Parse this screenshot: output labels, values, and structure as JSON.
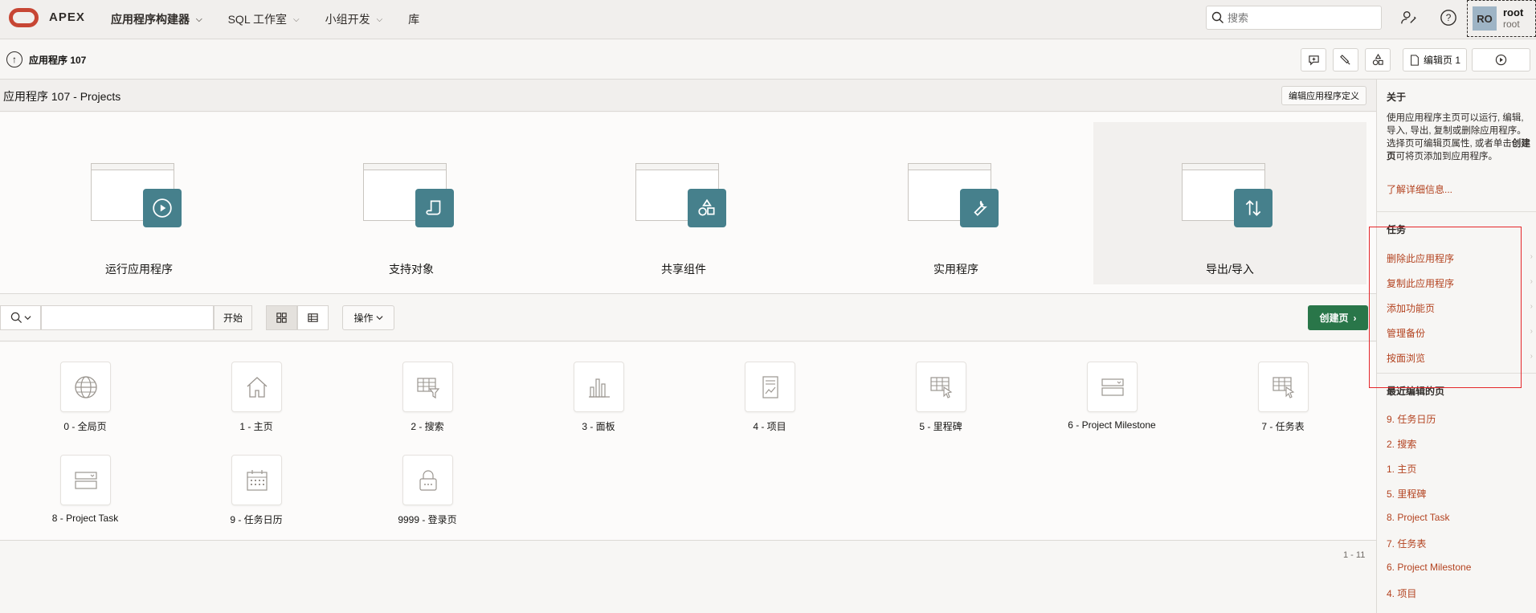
{
  "header": {
    "brand": "APEX",
    "nav": [
      {
        "label": "应用程序构建器",
        "has_menu": true,
        "active": true
      },
      {
        "label": "SQL 工作室",
        "has_menu": true,
        "active": false
      },
      {
        "label": "小组开发",
        "has_menu": true,
        "active": false
      },
      {
        "label": "库",
        "has_menu": false,
        "active": false
      }
    ],
    "search_placeholder": "搜索",
    "user": {
      "initials": "RO",
      "name": "root",
      "workspace": "root"
    }
  },
  "subbar": {
    "breadcrumb": "应用程序 107",
    "edit_page_label": "编辑页 1"
  },
  "region": {
    "title": "应用程序 107 - Projects",
    "edit_definition": "编辑应用程序定义"
  },
  "cards": [
    {
      "label": "运行应用程序",
      "icon": "play-icon"
    },
    {
      "label": "支持对象",
      "icon": "scroll-icon"
    },
    {
      "label": "共享组件",
      "icon": "shapes-icon"
    },
    {
      "label": "实用程序",
      "icon": "wrench-icon"
    },
    {
      "label": "导出/导入",
      "icon": "arrows-updown-icon"
    }
  ],
  "toolbar": {
    "go_label": "开始",
    "actions_label": "操作",
    "create_label": "创建页"
  },
  "pages": [
    {
      "label": "0 - 全局页",
      "icon": "globe-icon"
    },
    {
      "label": "1 - 主页",
      "icon": "home-icon"
    },
    {
      "label": "2 - 搜索",
      "icon": "table-filter-icon"
    },
    {
      "label": "3 - 面板",
      "icon": "bar-chart-icon"
    },
    {
      "label": "4 - 项目",
      "icon": "report-icon"
    },
    {
      "label": "5 - 里程碑",
      "icon": "grid-cursor-icon"
    },
    {
      "label": "6 - Project Milestone",
      "icon": "form-icon"
    },
    {
      "label": "7 - 任务表",
      "icon": "grid-cursor-icon"
    },
    {
      "label": "8 - Project Task",
      "icon": "form-icon"
    },
    {
      "label": "9 - 任务日历",
      "icon": "calendar-icon"
    },
    {
      "label": "9999 - 登录页",
      "icon": "lock-icon"
    }
  ],
  "pagination": "1 - 11",
  "sidebar": {
    "about_heading": "关于",
    "about_text_1": "使用应用程序主页可以运行, 编辑, 导入, 导出, 复制或删除应用程序。选择页可编辑页属性, 或者单击",
    "about_text_bold": "创建页",
    "about_text_2": "可将页添加到应用程序。",
    "learn_more": "了解详细信息...",
    "tasks_heading": "任务",
    "tasks": [
      "删除此应用程序",
      "复制此应用程序",
      "添加功能页",
      "管理备份",
      "按面浏览"
    ],
    "recent_heading": "最近编辑的页",
    "recent": [
      "9. 任务日历",
      "2. 搜索",
      "1. 主页",
      "5. 里程碑",
      "8. Project Task",
      "7. 任务表",
      "6. Project Milestone",
      "4. 项目"
    ]
  }
}
